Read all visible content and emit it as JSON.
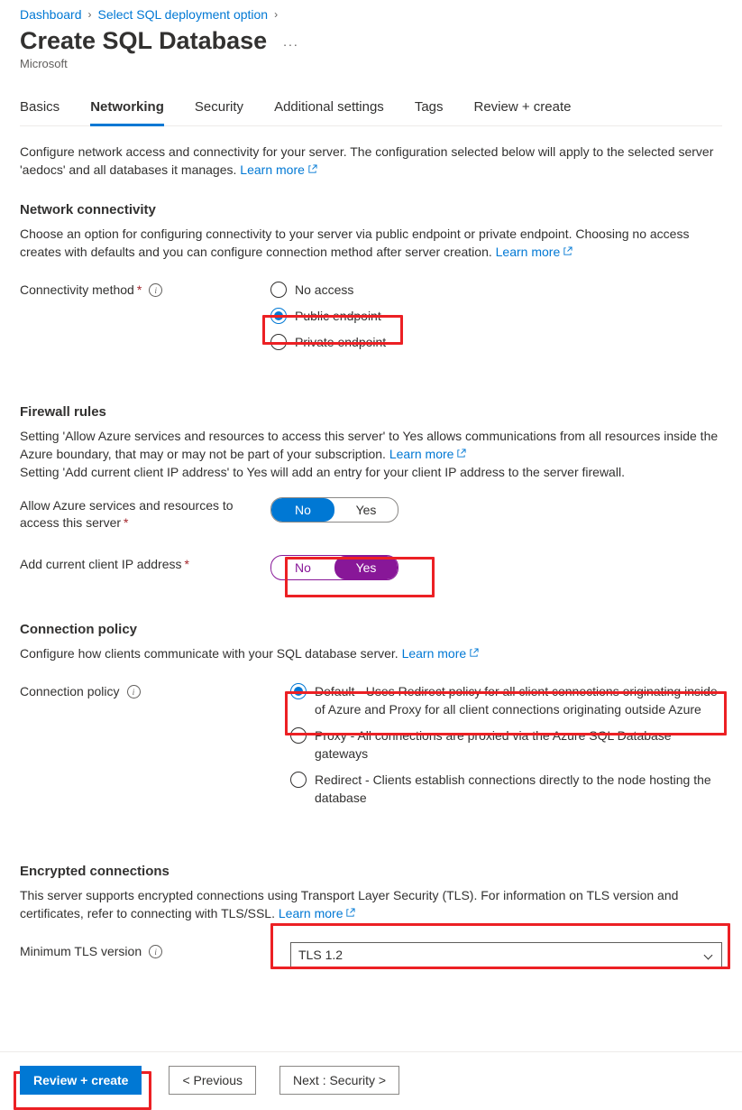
{
  "breadcrumbs": {
    "item1": "Dashboard",
    "item2": "Select SQL deployment option"
  },
  "page": {
    "title": "Create SQL Database",
    "subtitle": "Microsoft",
    "more": "..."
  },
  "tabs": {
    "t0": "Basics",
    "t1": "Networking",
    "t2": "Security",
    "t3": "Additional settings",
    "t4": "Tags",
    "t5": "Review + create"
  },
  "intro": {
    "text": "Configure network access and connectivity for your server. The configuration selected below will apply to the selected server 'aedocs' and all databases it manages. ",
    "learn": "Learn more"
  },
  "connectivity": {
    "heading": "Network connectivity",
    "desc": "Choose an option for configuring connectivity to your server via public endpoint or private endpoint. Choosing no access creates with defaults and you can configure connection method after server creation. ",
    "learn": "Learn more",
    "label": "Connectivity method",
    "opts": {
      "o0": "No access",
      "o1": "Public endpoint",
      "o2": "Private endpoint"
    }
  },
  "firewall": {
    "heading": "Firewall rules",
    "desc1a": "Setting 'Allow Azure services and resources to access this server' to Yes allows communications from all resources inside the Azure boundary, that may or may not be part of your subscription. ",
    "learn": "Learn more",
    "desc2": "Setting 'Add current client IP address' to Yes will add an entry for your client IP address to the server firewall.",
    "label1": "Allow Azure services and resources to access this server",
    "label2": "Add current client IP address",
    "no": "No",
    "yes": "Yes"
  },
  "connpolicy": {
    "heading": "Connection policy",
    "desc": "Configure how clients communicate with your SQL database server. ",
    "learn": "Learn more",
    "label": "Connection policy",
    "opts": {
      "o0": "Default - Uses Redirect policy for all client connections originating inside of Azure and Proxy for all client connections originating outside Azure",
      "o1": "Proxy - All connections are proxied via the Azure SQL Database gateways",
      "o2": "Redirect - Clients establish connections directly to the node hosting the database"
    }
  },
  "tls": {
    "heading": "Encrypted connections",
    "desc": "This server supports encrypted connections using Transport Layer Security (TLS). For information on TLS version and certificates, refer to connecting with TLS/SSL. ",
    "learn": "Learn more",
    "label": "Minimum TLS version",
    "value": "TLS 1.2"
  },
  "footer": {
    "review": "Review + create",
    "prev": "< Previous",
    "next": "Next : Security >"
  }
}
